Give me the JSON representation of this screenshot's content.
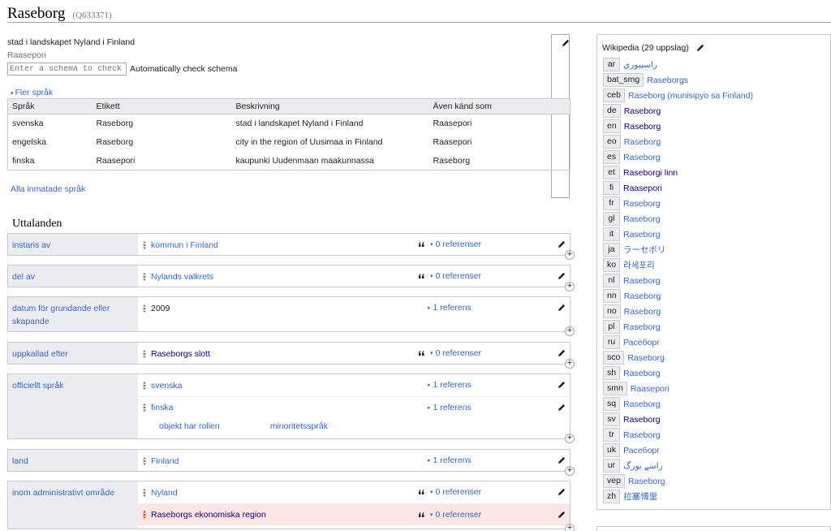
{
  "page": {
    "title": "Raseborg",
    "qid": "(Q633371)",
    "description": "stad i landskapet Nyland i Finland",
    "alias": "Raasepori",
    "schema_placeholder": "Enter a schema to check against",
    "schema_label": "Automatically check schema"
  },
  "terms": {
    "more_languages": "Fler språk",
    "headers": [
      "Språk",
      "Etikett",
      "Beskrivning",
      "Även känd som"
    ],
    "rows": [
      [
        "svenska",
        "Raseborg",
        "stad i landskapet Nyland i Finland",
        "Raasepori"
      ],
      [
        "engelska",
        "Raseborg",
        "city in the region of Uusimaa in Finland",
        "Raasepori"
      ],
      [
        "finska",
        "Raasepori",
        "kaupunki Uudenmaan maakunnassa",
        "Raseborg"
      ]
    ],
    "all_languages": "Alla inmatade språk"
  },
  "statements": {
    "heading": "Uttalanden",
    "items": [
      {
        "property": "instans av",
        "values": [
          {
            "text": "kommun i Finland",
            "refs": "0 referenser"
          }
        ]
      },
      {
        "property": "del av",
        "values": [
          {
            "text": "Nylands valkrets",
            "refs": "0 referenser"
          }
        ]
      },
      {
        "property": "datum för grundande eller skapande",
        "values": [
          {
            "text": "2009",
            "refs": "1 referens"
          }
        ]
      },
      {
        "property": "uppkallad efter",
        "values": [
          {
            "text": "Raseborgs slott",
            "refs": "0 referenser"
          }
        ]
      },
      {
        "property": "officiellt språk",
        "values": [
          {
            "text": "svenska",
            "refs": "1 referens"
          },
          {
            "text": "finska",
            "refs": "1 referens",
            "qualifier_property": "objekt har rollen",
            "qualifier_value": "minoritetsspråk"
          }
        ]
      },
      {
        "property": "land",
        "values": [
          {
            "text": "Finland",
            "refs": "1 referens"
          }
        ]
      },
      {
        "property": "inom administrativt område",
        "values": [
          {
            "text": "Nyland",
            "refs": "0 referenser"
          },
          {
            "text": "Raseborgs ekonomiska region",
            "refs": "0 referenser"
          }
        ]
      }
    ]
  },
  "wikipedia": {
    "heading": "Wikipedia",
    "count": "(29 uppslag)",
    "links": [
      {
        "code": "ar",
        "title": "راسيبوري"
      },
      {
        "code": "bat_smg",
        "title": "Raseborgs"
      },
      {
        "code": "ceb",
        "title": "Raseborg (munisipyo sa Finland)"
      },
      {
        "code": "de",
        "title": "Raseborg"
      },
      {
        "code": "en",
        "title": "Raseborg"
      },
      {
        "code": "eo",
        "title": "Raseborg"
      },
      {
        "code": "es",
        "title": "Raseborg"
      },
      {
        "code": "et",
        "title": "Raseborgi linn"
      },
      {
        "code": "fi",
        "title": "Raasepori"
      },
      {
        "code": "fr",
        "title": "Raseborg"
      },
      {
        "code": "gl",
        "title": "Raseborg"
      },
      {
        "code": "it",
        "title": "Raseborg"
      },
      {
        "code": "ja",
        "title": "ラーセボリ"
      },
      {
        "code": "ko",
        "title": "라세포리"
      },
      {
        "code": "nl",
        "title": "Raseborg"
      },
      {
        "code": "nn",
        "title": "Raseborg"
      },
      {
        "code": "no",
        "title": "Raseborg"
      },
      {
        "code": "pl",
        "title": "Raseborg"
      },
      {
        "code": "ru",
        "title": "Расеборг"
      },
      {
        "code": "sco",
        "title": "Raseborg"
      },
      {
        "code": "sh",
        "title": "Raseborg"
      },
      {
        "code": "smn",
        "title": "Raasepori"
      },
      {
        "code": "sq",
        "title": "Raseborg"
      },
      {
        "code": "sv",
        "title": "Raseborg"
      },
      {
        "code": "tr",
        "title": "Raseborg"
      },
      {
        "code": "uk",
        "title": "Расеборг"
      },
      {
        "code": "ur",
        "title": "راسے بورگ"
      },
      {
        "code": "vep",
        "title": "Raseborg"
      },
      {
        "code": "zh",
        "title": "拉塞博里"
      }
    ]
  },
  "colors": {
    "link": "#3366cc",
    "visited_link": "#0b0080",
    "deprecated_bg": "#fce6e6",
    "property_bg": "#eaecf0"
  }
}
